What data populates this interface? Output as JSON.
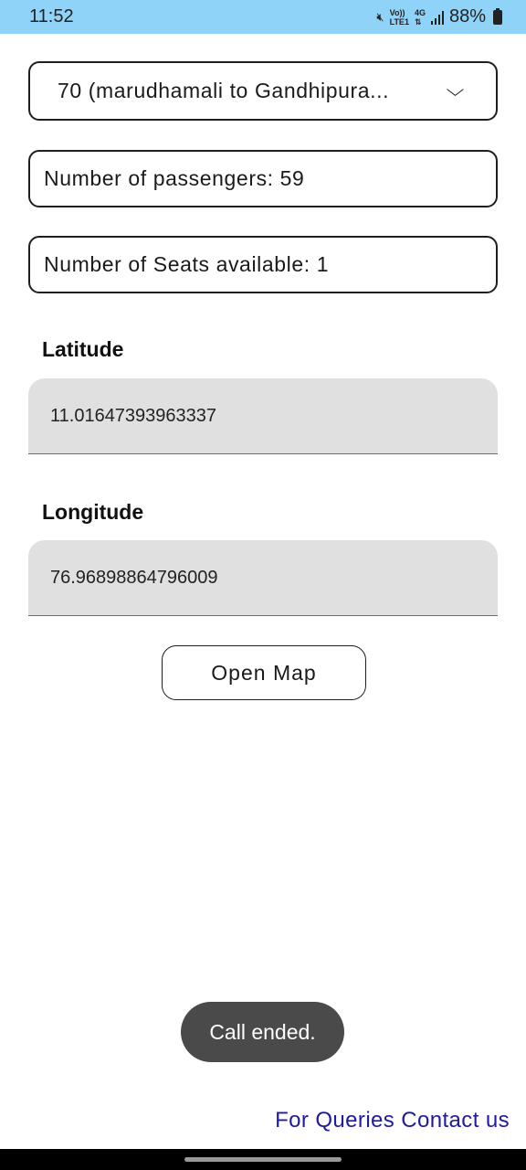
{
  "status_bar": {
    "time": "11:52",
    "network_top": "Vo))",
    "network_bottom": "LTE1",
    "network_type": "4G",
    "battery": "88%",
    "icons": [
      "mute-icon",
      "signal-icon",
      "battery-icon"
    ]
  },
  "route": {
    "selected": "70 (marudhamali to Gandhipura...",
    "chevron": "⌄"
  },
  "info": {
    "passengers": "Number of passengers: 59",
    "seats": "Number of Seats available: 1"
  },
  "latitude": {
    "label": "Latitude",
    "value": "11.01647393963337"
  },
  "longitude": {
    "label": "Longitude",
    "value": "76.96898864796009"
  },
  "actions": {
    "open_map": "Open Map"
  },
  "toast": {
    "message": "Call ended."
  },
  "footer": {
    "contact": "For Queries Contact us",
    "link_color": "#1f1aa0"
  }
}
